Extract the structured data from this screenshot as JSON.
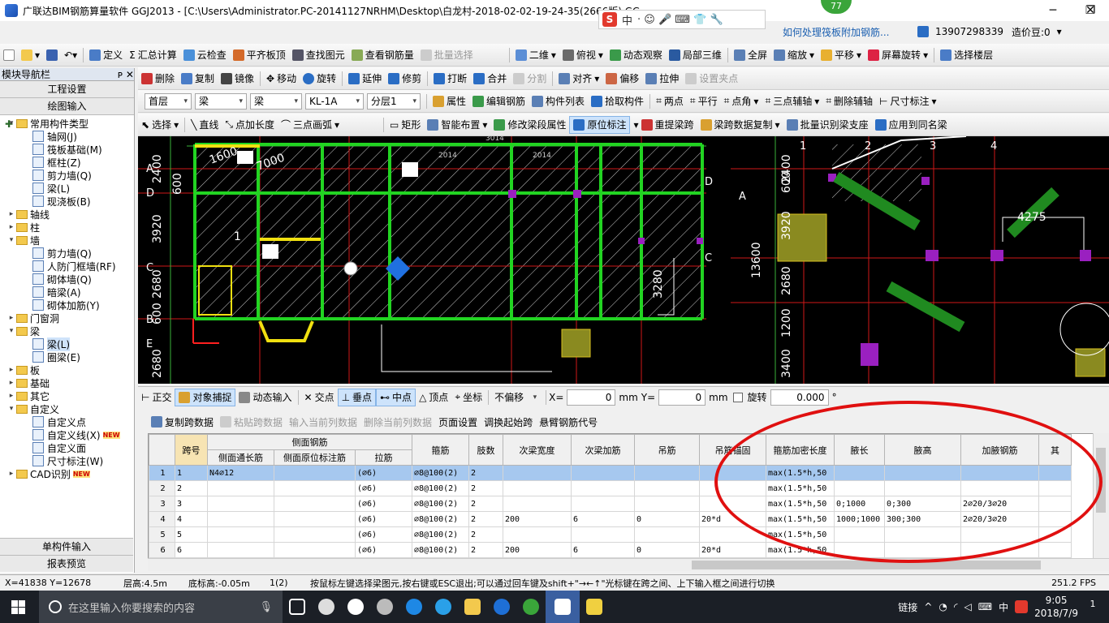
{
  "window": {
    "title": "广联达BIM钢筋算量软件 GGJ2013 - [C:\\Users\\Administrator.PC-20141127NRHM\\Desktop\\白龙村-2018-02-02-19-24-35(2666版).GGJ12]",
    "minimize": "─",
    "maximize": "❐",
    "close": "✕"
  },
  "ime": {
    "logo": "S",
    "mode": "中",
    "extras": "· ☺ 🎤 ⌨ 👕 🔧"
  },
  "badge": "77",
  "infobar": {
    "ad": "如何处理筏板附加钢筋...",
    "phone": "13907298339",
    "price": "造价豆:0"
  },
  "toolbar1": [
    "定义",
    "汇总计算",
    "云检查",
    "平齐板顶",
    "查找图元",
    "查看钢筋量",
    "批量选择",
    "二维",
    "俯视",
    "动态观察",
    "局部三维",
    "全屏",
    "缩放",
    "平移",
    "屏幕旋转",
    "选择楼层"
  ],
  "toolbar2": [
    "删除",
    "复制",
    "镜像",
    "移动",
    "旋转",
    "延伸",
    "修剪",
    "打断",
    "合并",
    "分割",
    "对齐",
    "偏移",
    "拉伸",
    "设置夹点"
  ],
  "toolbar3": {
    "floor": "首层",
    "cat1": "梁",
    "cat2": "梁",
    "name": "KL-1A",
    "layer": "分层1",
    "items": [
      "属性",
      "编辑钢筋",
      "构件列表",
      "拾取构件",
      "两点",
      "平行",
      "点角",
      "三点辅轴",
      "删除辅轴",
      "尺寸标注"
    ]
  },
  "toolbar4": [
    "选择",
    "直线",
    "点加长度",
    "三点画弧",
    "矩形",
    "智能布置",
    "修改梁段属性",
    "原位标注",
    "重提梁跨",
    "梁跨数据复制",
    "批量识别梁支座",
    "应用到同名梁"
  ],
  "nav": {
    "header": "模块导航栏",
    "pin": "ᴘ ✕",
    "sec1": "工程设置",
    "sec2": "绘图输入",
    "tools": "✚ ━",
    "tree": [
      {
        "t": "常用构件类型",
        "l": 0,
        "f": true,
        "e": "▾"
      },
      {
        "t": "轴网(J)",
        "l": 1
      },
      {
        "t": "筏板基础(M)",
        "l": 1
      },
      {
        "t": "框柱(Z)",
        "l": 1
      },
      {
        "t": "剪力墙(Q)",
        "l": 1
      },
      {
        "t": "梁(L)",
        "l": 1
      },
      {
        "t": "现浇板(B)",
        "l": 1
      },
      {
        "t": "轴线",
        "l": 0,
        "f": true,
        "e": "▸"
      },
      {
        "t": "柱",
        "l": 0,
        "f": true,
        "e": "▸"
      },
      {
        "t": "墙",
        "l": 0,
        "f": true,
        "e": "▾"
      },
      {
        "t": "剪力墙(Q)",
        "l": 1
      },
      {
        "t": "人防门框墙(RF)",
        "l": 1
      },
      {
        "t": "砌体墙(Q)",
        "l": 1
      },
      {
        "t": "暗梁(A)",
        "l": 1
      },
      {
        "t": "砌体加筋(Y)",
        "l": 1
      },
      {
        "t": "门窗洞",
        "l": 0,
        "f": true,
        "e": "▸"
      },
      {
        "t": "梁",
        "l": 0,
        "f": true,
        "e": "▾"
      },
      {
        "t": "梁(L)",
        "l": 1,
        "s": true
      },
      {
        "t": "圈梁(E)",
        "l": 1
      },
      {
        "t": "板",
        "l": 0,
        "f": true,
        "e": "▸"
      },
      {
        "t": "基础",
        "l": 0,
        "f": true,
        "e": "▸"
      },
      {
        "t": "其它",
        "l": 0,
        "f": true,
        "e": "▸"
      },
      {
        "t": "自定义",
        "l": 0,
        "f": true,
        "e": "▾"
      },
      {
        "t": "自定义点",
        "l": 1
      },
      {
        "t": "自定义线(X)",
        "l": 1,
        "n": "NEW"
      },
      {
        "t": "自定义面",
        "l": 1
      },
      {
        "t": "尺寸标注(W)",
        "l": 1
      },
      {
        "t": "CAD识别",
        "l": 0,
        "f": true,
        "e": "▸",
        "n": "NEW"
      }
    ],
    "foot1": "单构件输入",
    "foot2": "报表预览"
  },
  "canvas": {
    "leftdims": [
      "2400",
      "600",
      "3920",
      "2680",
      "600",
      "2680",
      "600"
    ],
    "axes": [
      "A",
      "D",
      "C",
      "B",
      "E",
      "D",
      "A",
      "C"
    ],
    "cols": [
      "1",
      "2",
      "3",
      "4"
    ],
    "rightdims": [
      "2400",
      "600",
      "3920",
      "2680",
      "1200",
      "3400"
    ],
    "midlabels": [
      "7000",
      "1600",
      "3280",
      "13600",
      "4275",
      "2014",
      "3014",
      "2014",
      "1"
    ]
  },
  "snap": {
    "items": [
      "正交",
      "对象捕捉",
      "动态输入",
      "交点",
      "垂点",
      "中点",
      "顶点",
      "坐标"
    ],
    "offset": "不偏移",
    "x_label": "X=",
    "x": "0",
    "unit1": "mm",
    "y_label": "Y=",
    "y": "0",
    "unit2": "mm",
    "rot_label": "旋转",
    "rot": "0.000",
    "deg": "°"
  },
  "gridtb": [
    "复制跨数据",
    "粘贴跨数据",
    "输入当前列数据",
    "删除当前列数据",
    "页面设置",
    "调换起始跨",
    "悬臂钢筋代号"
  ],
  "table": {
    "group_side": "侧面钢筋",
    "headers": [
      "跨号",
      "侧面通长筋",
      "侧面原位标注筋",
      "拉筋",
      "箍筋",
      "肢数",
      "次梁宽度",
      "次梁加筋",
      "吊筋",
      "吊筋锚固",
      "箍筋加密长度",
      "腋长",
      "腋高",
      "加腋钢筋",
      "其"
    ],
    "rows": [
      [
        "1",
        "N4⌀12",
        "",
        "(⌀6)",
        "⌀8@100(2)",
        "2",
        "",
        "",
        "",
        "",
        "max(1.5*h,50",
        "",
        "",
        ""
      ],
      [
        "2",
        "",
        "",
        "(⌀6)",
        "⌀8@100(2)",
        "2",
        "",
        "",
        "",
        "",
        "max(1.5*h,50",
        "",
        "",
        ""
      ],
      [
        "3",
        "",
        "",
        "(⌀6)",
        "⌀8@100(2)",
        "2",
        "",
        "",
        "",
        "",
        "max(1.5*h,50",
        "0;1000",
        "0;300",
        "2⌀20/3⌀20"
      ],
      [
        "4",
        "",
        "",
        "(⌀6)",
        "⌀8@100(2)",
        "2",
        "200",
        "6",
        "0",
        "20*d",
        "max(1.5*h,50",
        "1000;1000",
        "300;300",
        "2⌀20/3⌀20"
      ],
      [
        "5",
        "",
        "",
        "(⌀6)",
        "⌀8@100(2)",
        "2",
        "",
        "",
        "",
        "",
        "max(1.5*h,50",
        "",
        "",
        ""
      ],
      [
        "6",
        "",
        "",
        "(⌀6)",
        "⌀8@100(2)",
        "2",
        "200",
        "6",
        "0",
        "20*d",
        "max(1.5*h,50",
        "",
        "",
        ""
      ]
    ]
  },
  "status": {
    "coords": "X=41838 Y=12678",
    "floorh": "层高:4.5m",
    "base": "底标高:-0.05m",
    "sel": "1(2)",
    "hint": "按鼠标左键选择梁图元,按右键或ESC退出;可以通过回车键及shift+\"→←↑\"光标键在跨之间、上下输入框之间进行切换",
    "fps": "251.2 FPS"
  },
  "taskbar": {
    "search": "在这里输入你要搜索的内容",
    "tray_label": "链接",
    "lang": "中",
    "time": "9:05",
    "date": "2018/7/9",
    "notif": "1"
  },
  "colors": {
    "accent": "#1b5fb0",
    "highlight_oval": "#e01010",
    "row_selected": "#a6c8ef",
    "cad_bg": "#000000"
  }
}
